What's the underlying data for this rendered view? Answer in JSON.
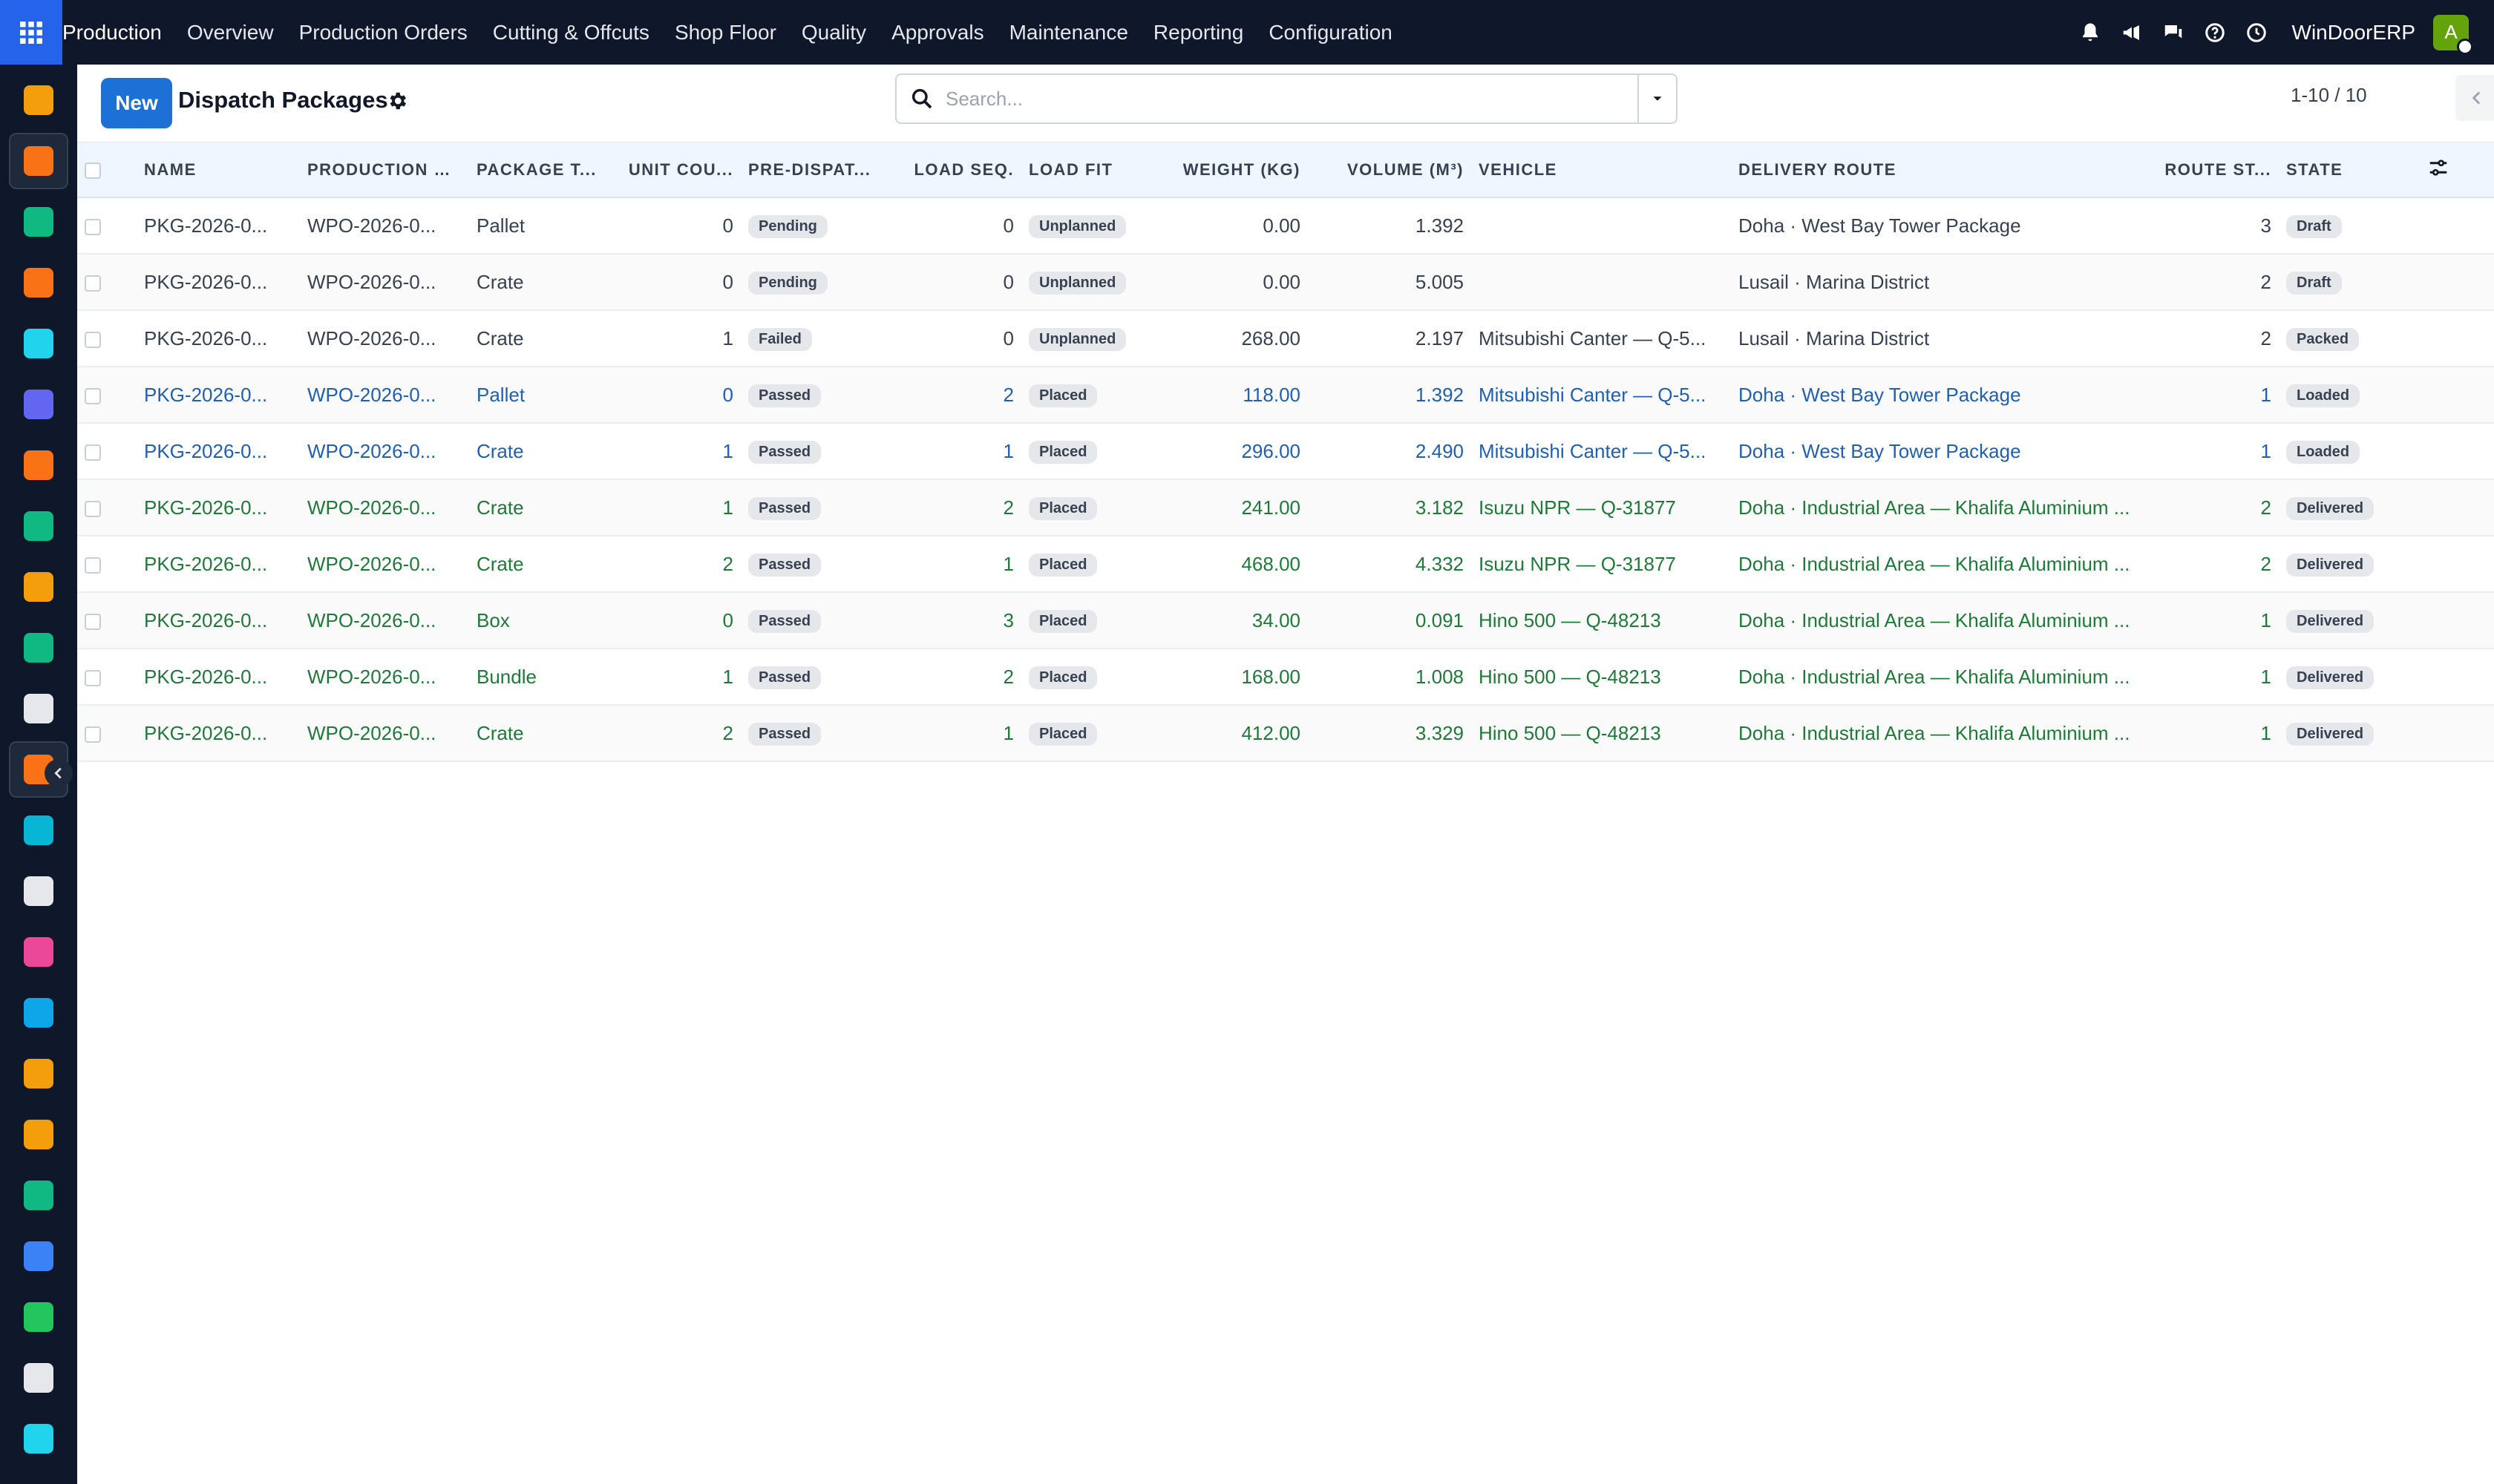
{
  "topbar": {
    "app_name": "Production",
    "menu": [
      "Overview",
      "Production Orders",
      "Cutting & Offcuts",
      "Shop Floor",
      "Quality",
      "Approvals",
      "Maintenance",
      "Reporting",
      "Configuration"
    ],
    "company": "WinDoorERP",
    "avatar_initial": "A",
    "icons": [
      "bell-icon",
      "megaphone-icon",
      "chat-icon",
      "help-icon",
      "clock-icon"
    ]
  },
  "sidebar": {
    "items": [
      {
        "name": "sidebar-app-1",
        "icon": "bar-chart-icon",
        "color": "#f59e0b"
      },
      {
        "name": "sidebar-app-2",
        "icon": "production-icon",
        "color": "#f97316",
        "active": true
      },
      {
        "name": "sidebar-app-3",
        "icon": "contacts-icon",
        "color": "#10b981"
      },
      {
        "name": "sidebar-app-4",
        "icon": "chat-bubble-icon",
        "color": "#f97316"
      },
      {
        "name": "sidebar-app-5",
        "icon": "wave-icon",
        "color": "#22d3ee"
      },
      {
        "name": "sidebar-app-6",
        "icon": "mail-icon",
        "color": "#6366f1"
      },
      {
        "name": "sidebar-app-7",
        "icon": "chat-bubble-icon",
        "color": "#f97316"
      },
      {
        "name": "sidebar-app-8",
        "icon": "check-ribbon-icon",
        "color": "#10b981"
      },
      {
        "name": "sidebar-app-9",
        "icon": "bar-chart-icon",
        "color": "#f59e0b"
      },
      {
        "name": "sidebar-app-10",
        "icon": "contacts-icon",
        "color": "#10b981"
      },
      {
        "name": "sidebar-app-11",
        "icon": "cube-icon",
        "color": "#e5e7eb"
      },
      {
        "name": "sidebar-app-12",
        "icon": "production-icon",
        "color": "#f97316",
        "active": true
      },
      {
        "name": "sidebar-app-13",
        "icon": "check-mark-icon",
        "color": "#06b6d4"
      },
      {
        "name": "sidebar-app-14",
        "icon": "book-icon",
        "color": "#e5e7eb"
      },
      {
        "name": "sidebar-app-15",
        "icon": "box-icon",
        "color": "#ec4899"
      },
      {
        "name": "sidebar-app-16",
        "icon": "dollar-icon",
        "color": "#0ea5e9"
      },
      {
        "name": "sidebar-app-17",
        "icon": "team-icon",
        "color": "#f59e0b"
      },
      {
        "name": "sidebar-app-18",
        "icon": "calendar-icon",
        "color": "#f59e0b"
      },
      {
        "name": "sidebar-app-19",
        "icon": "sign-icon",
        "color": "#10b981"
      },
      {
        "name": "sidebar-app-20",
        "icon": "dashboard-icon",
        "color": "#3b82f6"
      },
      {
        "name": "sidebar-app-21",
        "icon": "whatsapp-icon",
        "color": "#22c55e"
      },
      {
        "name": "sidebar-app-22",
        "icon": "gauge-icon",
        "color": "#e5e7eb"
      },
      {
        "name": "sidebar-app-23",
        "icon": "wave-icon",
        "color": "#22d3ee"
      }
    ]
  },
  "control": {
    "new_label": "New",
    "title": "Dispatch Packages",
    "search_placeholder": "Search...",
    "pager": "1-10 / 10"
  },
  "table": {
    "columns": [
      "Name",
      "Production O...",
      "Package T...",
      "Unit Cou...",
      "Pre-Dispat...",
      "Load Seq.",
      "Load Fit",
      "Weight (kg)",
      "Volume (m³)",
      "Vehicle",
      "Delivery Route",
      "Route St...",
      "State"
    ],
    "rows": [
      {
        "name": "PKG-2026-0...",
        "order": "WPO-2026-0...",
        "type": "Pallet",
        "units": "0",
        "pre": "Pending",
        "seq": "0",
        "fit": "Unplanned",
        "weight": "0.00",
        "volume": "1.392",
        "vehicle": "",
        "route": "Doha · West Bay Tower Package",
        "stop": "3",
        "state": "Draft"
      },
      {
        "name": "PKG-2026-0...",
        "order": "WPO-2026-0...",
        "type": "Crate",
        "units": "0",
        "pre": "Pending",
        "seq": "0",
        "fit": "Unplanned",
        "weight": "0.00",
        "volume": "5.005",
        "vehicle": "",
        "route": "Lusail · Marina District",
        "stop": "2",
        "state": "Draft"
      },
      {
        "name": "PKG-2026-0...",
        "order": "WPO-2026-0...",
        "type": "Crate",
        "units": "1",
        "pre": "Failed",
        "seq": "0",
        "fit": "Unplanned",
        "weight": "268.00",
        "volume": "2.197",
        "vehicle": "Mitsubishi Canter — Q-5...",
        "route": "Lusail · Marina District",
        "stop": "2",
        "state": "Packed"
      },
      {
        "name": "PKG-2026-0...",
        "order": "WPO-2026-0...",
        "type": "Pallet",
        "units": "0",
        "pre": "Passed",
        "seq": "2",
        "fit": "Placed",
        "weight": "118.00",
        "volume": "1.392",
        "vehicle": "Mitsubishi Canter — Q-5...",
        "route": "Doha · West Bay Tower Package",
        "stop": "1",
        "state": "Loaded"
      },
      {
        "name": "PKG-2026-0...",
        "order": "WPO-2026-0...",
        "type": "Crate",
        "units": "1",
        "pre": "Passed",
        "seq": "1",
        "fit": "Placed",
        "weight": "296.00",
        "volume": "2.490",
        "vehicle": "Mitsubishi Canter — Q-5...",
        "route": "Doha · West Bay Tower Package",
        "stop": "1",
        "state": "Loaded"
      },
      {
        "name": "PKG-2026-0...",
        "order": "WPO-2026-0...",
        "type": "Crate",
        "units": "1",
        "pre": "Passed",
        "seq": "2",
        "fit": "Placed",
        "weight": "241.00",
        "volume": "3.182",
        "vehicle": "Isuzu NPR — Q-31877",
        "route": "Doha · Industrial Area — Khalifa Aluminium ...",
        "stop": "2",
        "state": "Delivered"
      },
      {
        "name": "PKG-2026-0...",
        "order": "WPO-2026-0...",
        "type": "Crate",
        "units": "2",
        "pre": "Passed",
        "seq": "1",
        "fit": "Placed",
        "weight": "468.00",
        "volume": "4.332",
        "vehicle": "Isuzu NPR — Q-31877",
        "route": "Doha · Industrial Area — Khalifa Aluminium ...",
        "stop": "2",
        "state": "Delivered"
      },
      {
        "name": "PKG-2026-0...",
        "order": "WPO-2026-0...",
        "type": "Box",
        "units": "0",
        "pre": "Passed",
        "seq": "3",
        "fit": "Placed",
        "weight": "34.00",
        "volume": "0.091",
        "vehicle": "Hino 500 — Q-48213",
        "route": "Doha · Industrial Area — Khalifa Aluminium ...",
        "stop": "1",
        "state": "Delivered"
      },
      {
        "name": "PKG-2026-0...",
        "order": "WPO-2026-0...",
        "type": "Bundle",
        "units": "1",
        "pre": "Passed",
        "seq": "2",
        "fit": "Placed",
        "weight": "168.00",
        "volume": "1.008",
        "vehicle": "Hino 500 — Q-48213",
        "route": "Doha · Industrial Area — Khalifa Aluminium ...",
        "stop": "1",
        "state": "Delivered"
      },
      {
        "name": "PKG-2026-0...",
        "order": "WPO-2026-0...",
        "type": "Crate",
        "units": "2",
        "pre": "Passed",
        "seq": "1",
        "fit": "Placed",
        "weight": "412.00",
        "volume": "3.329",
        "vehicle": "Hino 500 — Q-48213",
        "route": "Doha · Industrial Area — Khalifa Aluminium ...",
        "stop": "1",
        "state": "Delivered"
      }
    ]
  },
  "colors": {
    "topbar_bg": "#0f172a",
    "accent": "#1d70d6",
    "loaded_text": "#1f5fb4",
    "delivered_text": "#1f7a3a"
  }
}
